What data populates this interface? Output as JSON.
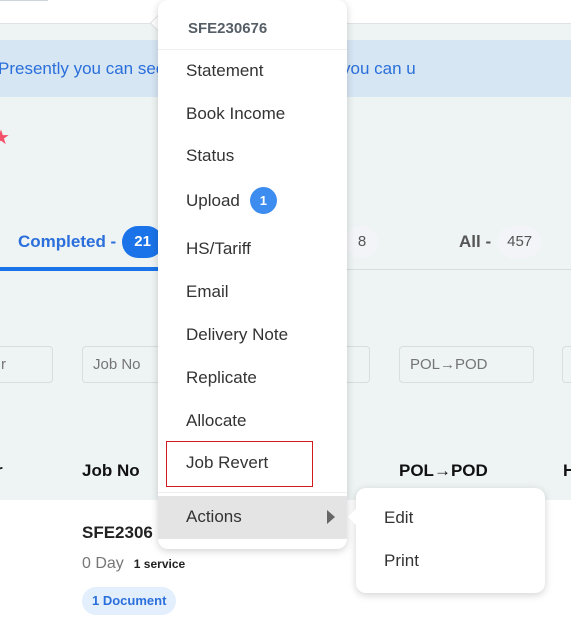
{
  "notice": {
    "text": "Presently you can see the jobs and if needed you can u",
    "left_visible": "Presently you can s",
    "right_visible": "obs and if needed you can u"
  },
  "tabs": [
    {
      "label": "Completed -",
      "count": "21",
      "active": true
    },
    {
      "label": "",
      "count": "8",
      "active": false
    },
    {
      "label": "All -",
      "count": "457",
      "active": false
    }
  ],
  "filters": [
    {
      "placeholder": "r"
    },
    {
      "placeholder": "Job No"
    },
    {
      "placeholder": ""
    },
    {
      "placeholder": "POL→POD"
    },
    {
      "placeholder": ""
    }
  ],
  "columns": [
    "r",
    "Job No",
    "POL→POD",
    "H"
  ],
  "row": {
    "job_no": "SFE2306",
    "days": "0 Day",
    "service": "1 service",
    "documents": "1 Document"
  },
  "context_menu": {
    "header": "SFE230676",
    "items": [
      {
        "label": "Statement"
      },
      {
        "label": "Book Income"
      },
      {
        "label": "Status"
      },
      {
        "label": "Upload",
        "badge": "1"
      },
      {
        "label": "HS/Tariff"
      },
      {
        "label": "Email"
      },
      {
        "label": "Delivery Note"
      },
      {
        "label": "Replicate"
      },
      {
        "label": "Allocate"
      },
      {
        "label": "Job Revert",
        "highlighted": true
      }
    ],
    "actions_label": "Actions",
    "highlight_color": "#d11a1a"
  },
  "submenu": {
    "items": [
      {
        "label": "Edit"
      },
      {
        "label": "Print"
      }
    ]
  },
  "colors": {
    "accent": "#1a73e8",
    "notice_bg": "#d6e6f3",
    "star": "#f4506a"
  }
}
